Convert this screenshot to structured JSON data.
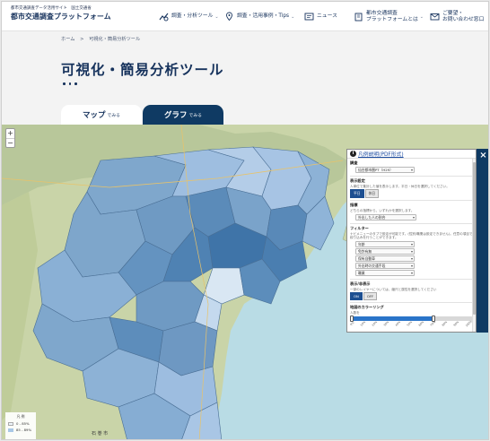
{
  "header": {
    "logo_sub": "都市交通調査データ活用サイト　国土交通省",
    "logo_main": "都市交通調査プラットフォーム",
    "nav": [
      {
        "label": "調査・分析ツール",
        "icon": "chart-tools-icon"
      },
      {
        "label": "調査・活用事例・Tips",
        "icon": "map-pin-icon"
      },
      {
        "label": "ニュース",
        "icon": "news-icon"
      },
      {
        "label_line1": "都市交通調査",
        "label_line2": "プラットフォームとは",
        "icon": "building-icon"
      },
      {
        "label_line1": "ご要望・",
        "label_line2": "お問い合わせ窓口",
        "icon": "mail-icon"
      }
    ]
  },
  "breadcrumb": [
    "ホーム",
    ">",
    "可視化・簡易分析ツール"
  ],
  "page_title": "可視化・簡易分析ツール",
  "tabs": {
    "map_big": "マップ",
    "map_small": "でみる",
    "graph_big": "グラフ",
    "graph_small": "でみる"
  },
  "map": {
    "zoom_in": "+",
    "zoom_out": "−",
    "legend_title": "凡 例",
    "legend_rows": [
      {
        "label": "0 - 85%",
        "color": "#eef5fb"
      },
      {
        "label": "85 - 89%",
        "color": "#a9c8e6"
      }
    ],
    "place_label": "石 巻 市"
  },
  "panel": {
    "link": "凡例説明(PDF形式)",
    "sections": [
      {
        "label": "調査",
        "select": "仙台都市圏PT（H29）"
      },
      {
        "label": "表示設定",
        "desc": "人単位で集計した値を表示します。平日・休日を選択してください。",
        "buttons": [
          "平日",
          "休日"
        ]
      },
      {
        "label": "指標",
        "desc": "どちらの指標から、いずれかを選択します。",
        "select": "外出した人の割合"
      },
      {
        "label": "フィルター",
        "desc": "ナビメニューのタブで設定が可能です。(性別/職業は設定できません)。任意の項目で絞り込みを行うことができます。",
        "selects": [
          "年齢",
          "免許有無",
          "保有自動車",
          "外出時の交通手段",
          "職業"
        ]
      },
      {
        "label": "表示/非表示",
        "desc": "一部のレイヤーについては、縮尺と属性を選択してください",
        "buttons": [
          "ON",
          "OFF"
        ]
      },
      {
        "label": "地図のカラーリング",
        "select_text": "人数を",
        "ticks": [
          "0%",
          "10%",
          "20%",
          "30%",
          "40%",
          "50%",
          "60%",
          "70%",
          "80%",
          "90%",
          "100%"
        ],
        "fill_percent": 68
      }
    ]
  },
  "close_label": "×"
}
